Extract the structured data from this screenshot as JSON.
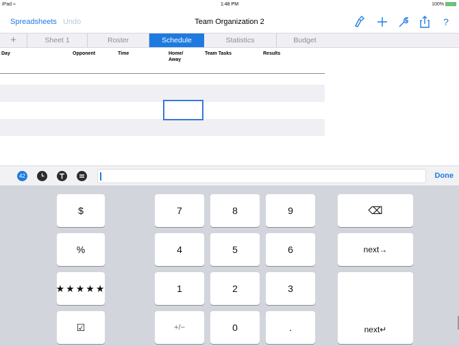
{
  "status": {
    "carrier": "iPad",
    "time": "1:48 PM",
    "battery": "100%"
  },
  "nav": {
    "back": "Spreadsheets",
    "undo": "Undo",
    "title": "Team Organization 2",
    "icons": [
      "brush-icon",
      "plus-icon",
      "wrench-icon",
      "share-icon",
      "help-icon"
    ]
  },
  "tabs": {
    "add": "+",
    "items": [
      "Sheet 1",
      "Roster",
      "Schedule",
      "Statistics",
      "Budget"
    ],
    "active": "Schedule"
  },
  "table": {
    "headers": [
      "Day",
      "Opponent",
      "Time",
      "Home/ Away",
      "Team Tasks",
      "Results"
    ]
  },
  "formula_bar": {
    "buttons": [
      "42",
      "clock-icon",
      "text-icon",
      "equals-icon"
    ],
    "done": "Done"
  },
  "keyboard": {
    "keys": [
      "$",
      "%",
      "★★★★★",
      "☑",
      "7",
      "8",
      "9",
      "4",
      "5",
      "6",
      "1",
      "2",
      "3",
      "+/−",
      "0",
      ".",
      "⌫",
      "next→",
      "next↵"
    ]
  }
}
